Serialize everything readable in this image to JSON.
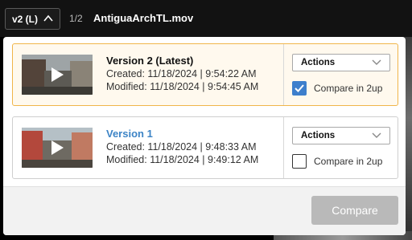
{
  "topbar": {
    "version_select": "v2 (L)",
    "page_count": "1/2",
    "file_name": "AntiguaArchTL.mov"
  },
  "versions": [
    {
      "title": "Version 2 (Latest)",
      "created": "Created: 11/18/2024 | 9:54:22 AM",
      "modified": "Modified: 11/18/2024 | 9:54:45 AM",
      "actions_label": "Actions",
      "compare_label": "Compare in 2up",
      "compare_checked": true,
      "active": true
    },
    {
      "title": "Version 1",
      "created": "Created: 11/18/2024 | 9:48:33 AM",
      "modified": "Modified: 11/18/2024 | 9:49:12 AM",
      "actions_label": "Actions",
      "compare_label": "Compare in 2up",
      "compare_checked": false,
      "active": false
    }
  ],
  "footer": {
    "compare_button": "Compare"
  },
  "colors": {
    "accent": "#3d7fcc",
    "active_border": "#f0b54a",
    "link": "#3d84c6"
  },
  "icons": [
    "chevron-up-icon",
    "chevron-down-icon",
    "play-icon",
    "checkmark-icon"
  ]
}
